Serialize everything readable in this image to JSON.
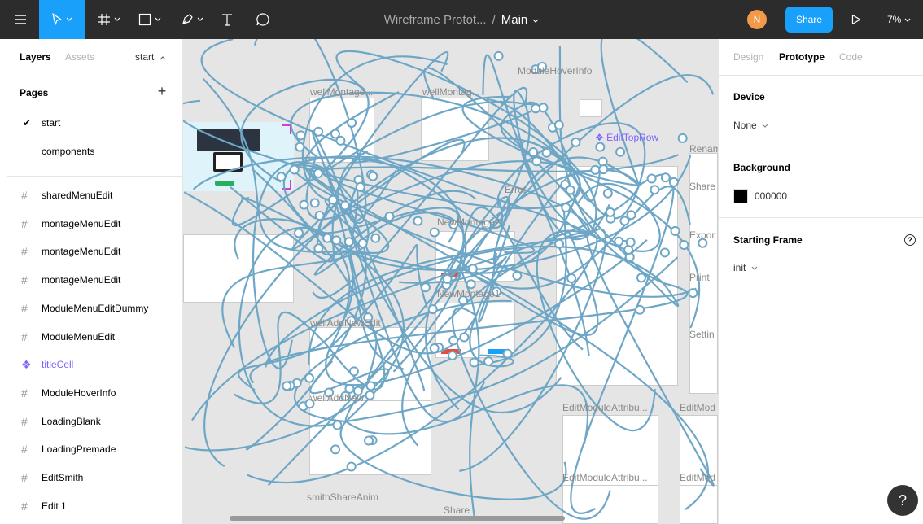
{
  "toolbar": {
    "project_name": "Wireframe Protot...",
    "separator": "/",
    "page_name": "Main",
    "user_initial": "N",
    "share_label": "Share",
    "zoom_label": "7%",
    "accent_color": "#18a0fb"
  },
  "left_panel": {
    "tabs": {
      "layers": "Layers",
      "assets": "Assets",
      "current_page": "start"
    },
    "pages_title": "Pages",
    "add_icon": "+",
    "pages": [
      {
        "label": "start",
        "selected": true
      },
      {
        "label": "components",
        "selected": false
      }
    ],
    "layers": [
      {
        "label": "sharedMenuEdit",
        "icon": "frame-icon"
      },
      {
        "label": "montageMenuEdit",
        "icon": "frame-icon"
      },
      {
        "label": "montageMenuEdit",
        "icon": "frame-icon"
      },
      {
        "label": "montageMenuEdit",
        "icon": "frame-icon"
      },
      {
        "label": "ModuleMenuEditDummy",
        "icon": "frame-icon"
      },
      {
        "label": "ModuleMenuEdit",
        "icon": "frame-icon"
      },
      {
        "label": "titleCell",
        "icon": "component-icon"
      },
      {
        "label": "ModuleHoverInfo",
        "icon": "frame-icon"
      },
      {
        "label": "LoadingBlank",
        "icon": "frame-icon"
      },
      {
        "label": "LoadingPremade",
        "icon": "frame-icon"
      },
      {
        "label": "EditSmith",
        "icon": "frame-icon"
      },
      {
        "label": "Edit 1",
        "icon": "frame-icon"
      }
    ]
  },
  "canvas": {
    "frame_labels": {
      "well_montage_1": "wellMontage...",
      "well_montage_2": "wellMontag...",
      "module_hover_info": "ModuleHoverInfo",
      "edit_top_row": "EditTopRow",
      "error": "Error",
      "new_montage_2": "NewMontage2",
      "new_montage_1": "NewMontage1",
      "add_new_1": "wellAddNewEdit",
      "add_new_2": "wellAddNew",
      "edit_module_attr_1": "EditModuleAttribu...",
      "edit_module_attr_2": "EditModuleAttribu...",
      "edit_mod_1": "EditMod",
      "edit_mod_2": "EditMod",
      "share": "Share",
      "smith_share_anim": "smithShareAnim",
      "rename": "Rename",
      "share_side": "Share",
      "export": "Expor",
      "print": "Print",
      "settings": "Settin"
    },
    "wire_color": "#6ea6c6",
    "component_color": "#7b61ff"
  },
  "right_panel": {
    "tabs": {
      "design": "Design",
      "prototype": "Prototype",
      "code": "Code"
    },
    "device": {
      "title": "Device",
      "value": "None"
    },
    "background": {
      "title": "Background",
      "hex": "000000",
      "color": "#000000"
    },
    "starting_frame": {
      "title": "Starting Frame",
      "value": "init"
    },
    "help_fab": "?"
  }
}
